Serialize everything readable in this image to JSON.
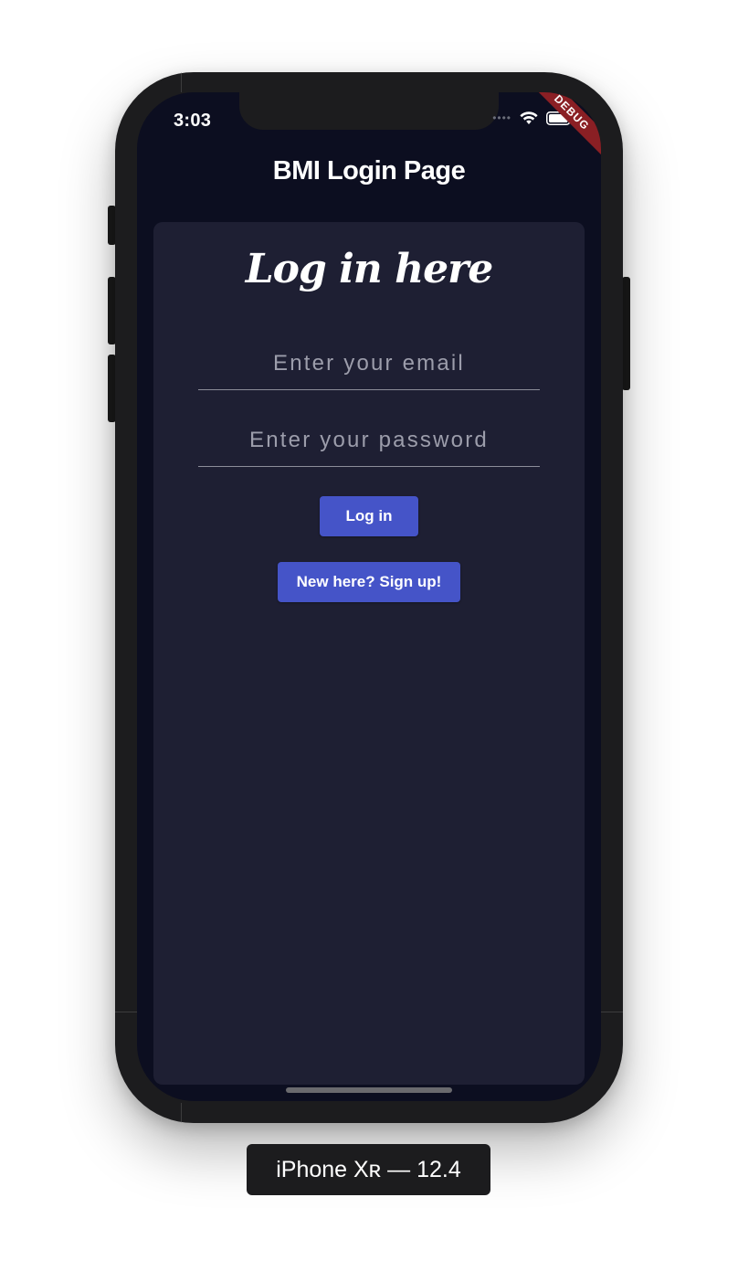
{
  "status_bar": {
    "time": "3:03",
    "signal_icon": "signal-dots-icon",
    "wifi_icon": "wifi-icon",
    "battery_icon": "battery-icon"
  },
  "debug_banner": "DEBUG",
  "app_bar": {
    "title": "BMI Login Page"
  },
  "card": {
    "heading": "Log in here",
    "email_placeholder": "Enter your email",
    "email_value": "",
    "password_placeholder": "Enter your password",
    "password_value": "",
    "login_button": "Log in",
    "signup_button": "New here? Sign up!"
  },
  "device_caption": "iPhone Xʀ — 12.4",
  "colors": {
    "screen_background": "#0c0e20",
    "card_background": "#1e1f33",
    "button_accent": "#4554c8",
    "debug_banner": "#8a1f24",
    "device_frame": "#1c1c1e"
  }
}
